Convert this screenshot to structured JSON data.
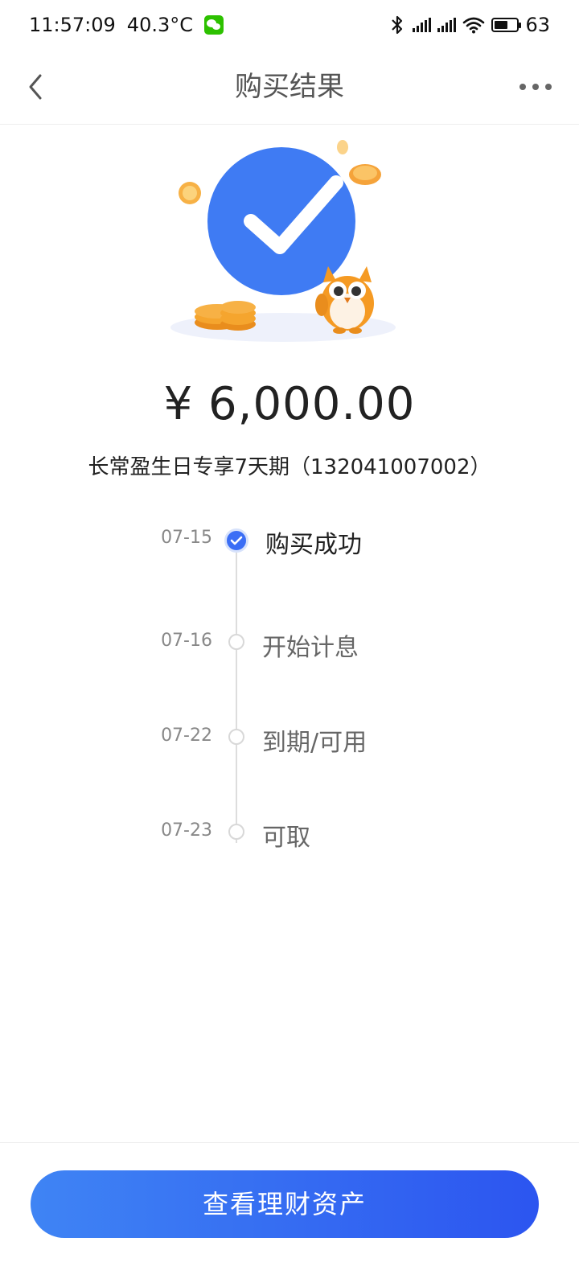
{
  "status_bar": {
    "time": "11:57:09",
    "temperature": "40.3°C",
    "battery_level": "63",
    "battery_fraction": 0.63
  },
  "nav": {
    "title": "购买结果",
    "back_icon": "chevron-left-icon",
    "more_icon": "more-dots-icon"
  },
  "result": {
    "amount": "¥ 6,000.00",
    "product": "长常盈生日专享7天期（132041007002）"
  },
  "timeline": [
    {
      "date": "07-15",
      "label": "购买成功",
      "status": "done"
    },
    {
      "date": "07-16",
      "label": "开始计息",
      "status": "pending"
    },
    {
      "date": "07-22",
      "label": "到期/可用",
      "status": "pending"
    },
    {
      "date": "07-23",
      "label": "可取",
      "status": "pending"
    }
  ],
  "actions": {
    "view_assets": "查看理财资产"
  },
  "colors": {
    "primary": "#3b6ef5",
    "coin": "#f5a623",
    "check_circle": "#3f7bf3"
  }
}
